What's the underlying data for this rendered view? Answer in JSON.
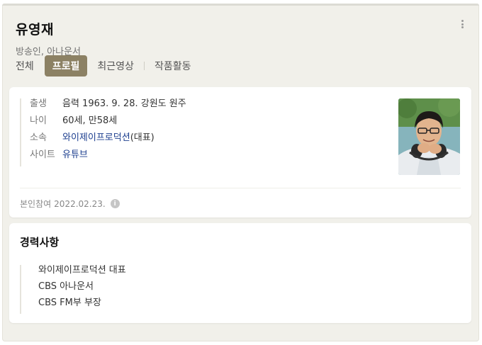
{
  "profile": {
    "name": "유영재",
    "subtitle": "방송인, 아나운서"
  },
  "tabs": [
    "전체",
    "프로필",
    "최근영상",
    "작품활동"
  ],
  "active_tab": 1,
  "info": {
    "birth_label": "출생",
    "birth_value": "음력 1963. 9. 28. 강원도 원주",
    "age_label": "나이",
    "age_value": "60세, 만58세",
    "agency_label": "소속",
    "agency_link": "와이제이프로덕션",
    "agency_suffix": "(대표)",
    "site_label": "사이트",
    "site_value": "유튜브"
  },
  "verify": {
    "label": "본인참여",
    "date": "2022.02.23.",
    "icon": "info-icon"
  },
  "career": {
    "title": "경력사항",
    "items": [
      "와이제이프로덕션 대표",
      "CBS 아나운서",
      "CBS FM부 부장"
    ]
  },
  "colors": {
    "accent": "#8c8164",
    "link": "#1d3f8f",
    "background": "#f1f0ea"
  }
}
